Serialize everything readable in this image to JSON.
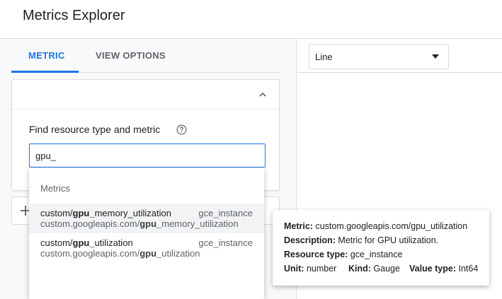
{
  "header": {
    "title": "Metrics Explorer"
  },
  "tabs": [
    {
      "label": "METRIC",
      "active": true
    },
    {
      "label": "VIEW OPTIONS",
      "active": false
    }
  ],
  "query": {
    "find_label": "Find resource type and metric",
    "search_value": "gpu_",
    "help_icon": "help-circle-icon",
    "collapse_icon": "chevron-up-icon",
    "add_icon": "plus-icon"
  },
  "chart_type": {
    "selected": "Line",
    "icon": "caret-down-icon"
  },
  "suggestions": {
    "section_label": "Metrics",
    "items": [
      {
        "title_prefix": "custom/",
        "title_match": "gpu_",
        "title_rest": "memory_utilization",
        "resource": "gce_instance",
        "sub_prefix": "custom.googleapis.com/",
        "sub_match": "gpu_",
        "sub_rest": "memory_utilization"
      },
      {
        "title_prefix": "custom/",
        "title_match": "gpu_",
        "title_rest": "utilization",
        "resource": "gce_instance",
        "sub_prefix": "custom.googleapis.com/",
        "sub_match": "gpu_",
        "sub_rest": "utilization"
      }
    ]
  },
  "tooltip": {
    "metric_label": "Metric:",
    "metric_value": "custom.googleapis.com/gpu_utilization",
    "description_label": "Description:",
    "description_value": "Metric for GPU utilization.",
    "resource_type_label": "Resource type:",
    "resource_type_value": "gce_instance",
    "unit_label": "Unit:",
    "unit_value": "number",
    "kind_label": "Kind:",
    "kind_value": "Gauge",
    "value_type_label": "Value type:",
    "value_type_value": "Int64"
  },
  "colors": {
    "accent": "#1a73e8",
    "hover_row": "#f1f3f4",
    "panel_bg": "#f8f9fa"
  }
}
